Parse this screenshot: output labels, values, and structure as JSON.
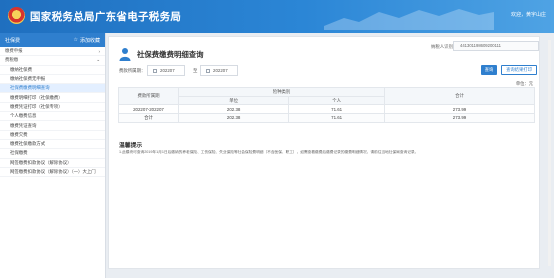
{
  "header": {
    "title": "国家税务总局广东省电子税务局",
    "user_info": "欢迎，黄宇山庄"
  },
  "sidebar": {
    "head_label": "社保费",
    "favorite_label": "添加收藏",
    "items": [
      {
        "label": "缴费申报",
        "group": true
      },
      {
        "label": "费税缴",
        "group": true
      },
      {
        "label": "缴纳社保费",
        "group": false
      },
      {
        "label": "缴纳社保费无申报",
        "group": false
      },
      {
        "label": "社保费缴费明细查询",
        "group": false,
        "active": true
      },
      {
        "label": "缴费明细打印（社保缴费）",
        "group": false
      },
      {
        "label": "缴费凭证打印（社保专项）",
        "group": false
      },
      {
        "label": "个人缴费信息",
        "group": false
      },
      {
        "label": "缴费凭证查询",
        "group": false
      },
      {
        "label": "缴费欠费",
        "group": false
      },
      {
        "label": "缴费社保缴款方式",
        "group": false
      },
      {
        "label": "社保缴费",
        "group": false
      },
      {
        "label": "网签缴费扣款协议（解除协议）",
        "group": false
      },
      {
        "label": "网签缴费扣款协议（解除协议）（一）大上门",
        "group": false
      }
    ]
  },
  "main": {
    "page_title": "社保费缴费明细查询",
    "id_label": "纳税人识别号",
    "id_value": "441301198609200111",
    "filter_label": "费款所属期：",
    "date_from": "202207",
    "to_label": "至",
    "date_to": "202207",
    "query_button": "查询",
    "print_button": "查询结果打印",
    "unit_label": "单位：元",
    "table": {
      "col_period": "费款所属期",
      "col_type": "险种类别",
      "col_unit": "单位",
      "col_person": "个人",
      "col_total": "合计",
      "rows": [
        {
          "period": "202207-202207",
          "unit": "202.38",
          "person": "71.61",
          "total": "273.99"
        },
        {
          "period": "合计",
          "unit": "202.38",
          "person": "71.61",
          "total": "273.99"
        }
      ]
    },
    "notes_title": "温馨提示",
    "notes_text": "1.此模块可查询2019年1月1日后缴纳的养老保险、工伤保险、失业保险等社会保险费明细（不含医保、职工），如需查看缴费后缴费记录的缴费明细情况，请前往当地社保局查询记录。"
  },
  "colors": {
    "header_blue": "#2b86d6",
    "accent": "#2f7fce"
  }
}
